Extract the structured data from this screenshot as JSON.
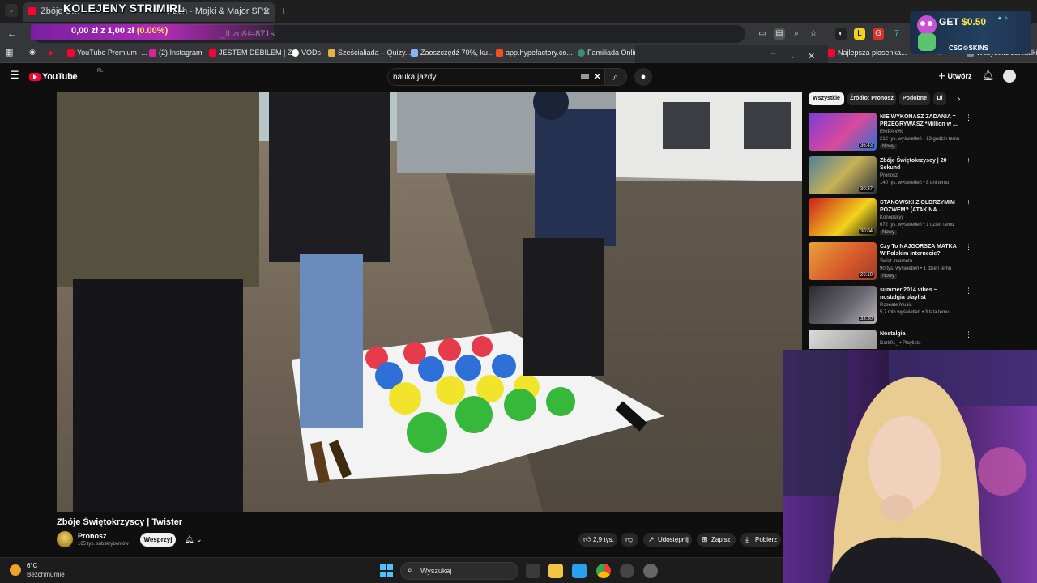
{
  "stream": {
    "title": "KOLEJENY STRIMIRL",
    "donation_text": "0,00 zł z 1,00 zł",
    "donation_pct": "(0.00%)"
  },
  "browser": {
    "active_tab_title": "Zbóje Ś…",
    "other_tab_title": "Pach - Majki & Major SP2",
    "url_visible": "_ILzc&t=871s",
    "bookmarks": [
      "YouTube Premium -...",
      "(2) Instagram",
      "JESTEM DEBILEM | Z...",
      "VODs",
      "Sześcialiada – Quizy...",
      "Zaoszczędź 70%, ku...",
      "app.hypefactory.co...",
      "Familiada Online"
    ],
    "bookmarks_right": "Najlepsza piosenka...",
    "bookmarks_all": "Wszystkie zakładki"
  },
  "youtube": {
    "logo_text": "YouTube",
    "country": "PL",
    "search_value": "nauka jazdy",
    "create_label": "Utwórz",
    "video_title": "Zbóje Świętokrzyscy | Twister",
    "channel_name": "Pronosz",
    "channel_subs": "165 tys. subskrybentów",
    "support_label": "Wesprzyj",
    "like_count": "2,9 tys.",
    "share_label": "Udostępnij",
    "save_label": "Zapisz",
    "download_label": "Pobierz",
    "chips": [
      "Wszystkie",
      "Źródło: Pronosz",
      "Podobne",
      "Dl"
    ],
    "related": [
      {
        "title": "NIE WYKONASZ ZADANIA = PRZEGRYWASZ *Million w ...",
        "channel": "EKIPA WK",
        "meta": "212 tys. wyświetleń • 13 godzin temu",
        "badge": "Nowy",
        "duration": "36:43"
      },
      {
        "title": "Zbóje Świętokrzyscy | 20 Sekund",
        "channel": "Pronosz",
        "meta": "140 tys. wyświetleń • 8 dni temu",
        "badge": "",
        "duration": "30:37"
      },
      {
        "title": "STANOWSKI Z OLBRZYMIM POZWEM? (ATAK NA ...",
        "channel": "Konopskyy",
        "meta": "672 tys. wyświetleń • 1 dzień temu",
        "badge": "Nowy",
        "duration": "30:04"
      },
      {
        "title": "Czy To NAJGORSZA MATKA W Polskim Internecie?",
        "channel": "Świat Internetu",
        "meta": "90 tys. wyświetleń • 1 dzień temu",
        "badge": "Nowy",
        "duration": "26:10"
      },
      {
        "title": "summer 2014 vibes ~ nostalgia playlist",
        "channel": "Roseate Music",
        "meta": "5,7 mln wyświetleń • 3 lata temu",
        "badge": "",
        "duration": "33:30"
      },
      {
        "title": "Nostalgia",
        "channel": "Dark01_ • Playlista",
        "meta": "",
        "badge": "",
        "duration": ""
      }
    ]
  },
  "promo": {
    "get": "GET",
    "amount": "$0.50",
    "brand": "CSG⚙SKINS"
  },
  "taskbar": {
    "temp": "6°C",
    "weather": "Bezchmurnie",
    "search_label": "Wyszukaj"
  },
  "colors": {
    "youtube_red": "#ff0033",
    "donation_purple": "#b12ab8",
    "accent_blue": "#4cc2ff"
  }
}
